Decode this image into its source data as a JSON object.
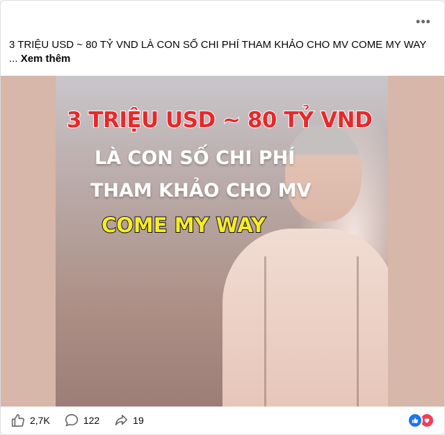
{
  "post": {
    "caption": "3 TRIỆU USD ~ 80 TỶ VND LÀ CON SỐ CHI PHÍ THAM KHẢO CHO MV COME MY WAY ...",
    "see_more": "Xem thêm",
    "more_icon": "more-horizontal-icon"
  },
  "image": {
    "line1": "3 TRIỆU USD ~ 80 TỶ VND",
    "line2": "LÀ CON SỐ CHI PHÍ",
    "line3": "THAM KHẢO CHO MV",
    "line4": "COME MY WAY",
    "colors": {
      "line1": "#e8282b",
      "line4": "#f5ec2a",
      "background": "#d6b7a9"
    }
  },
  "actions": {
    "like_count": "2,7K",
    "comment_count": "122",
    "share_count": "19",
    "icons": [
      "like-icon",
      "comment-icon",
      "share-icon"
    ]
  },
  "reactions": [
    "like-reaction-icon",
    "love-reaction-icon"
  ]
}
